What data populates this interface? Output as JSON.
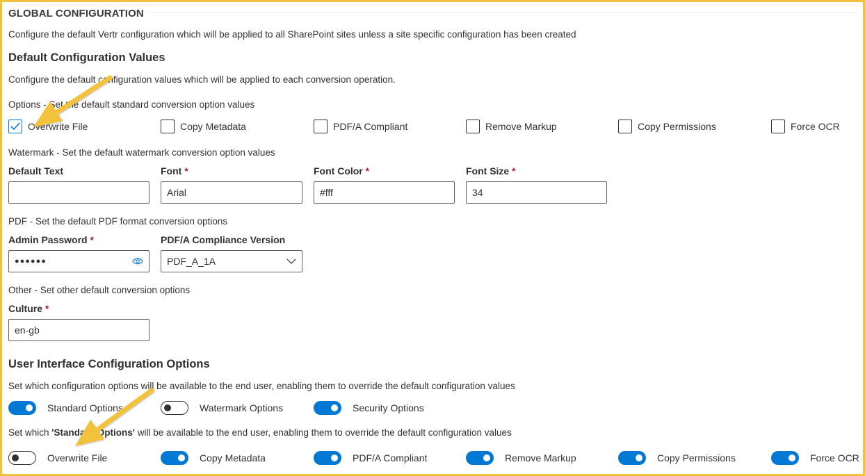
{
  "header": {
    "title": "GLOBAL CONFIGURATION",
    "description": "Configure the default Vertr configuration which will be applied to all SharePoint sites unless a site specific configuration has been created"
  },
  "defaults": {
    "heading": "Default Configuration Values",
    "description": "Configure the default configuration values which will be applied to each conversion operation."
  },
  "options": {
    "label": "Options",
    "description": " - Set the default standard conversion option values",
    "items": [
      {
        "label": "Overwrite File",
        "checked": true
      },
      {
        "label": "Copy Metadata",
        "checked": false
      },
      {
        "label": "PDF/A Compliant",
        "checked": false
      },
      {
        "label": "Remove Markup",
        "checked": false
      },
      {
        "label": "Copy Permissions",
        "checked": false
      },
      {
        "label": "Force OCR",
        "checked": false
      }
    ]
  },
  "watermark": {
    "label": "Watermark",
    "description": " - Set the default watermark conversion option values",
    "fields": [
      {
        "label": "Default Text",
        "required": "",
        "value": ""
      },
      {
        "label": "Font",
        "required": "*",
        "value": "Arial"
      },
      {
        "label": "Font Color",
        "required": "*",
        "value": "#fff"
      },
      {
        "label": "Font Size",
        "required": "*",
        "value": "34"
      }
    ]
  },
  "pdf": {
    "label": "PDF",
    "description": " - Set the default PDF format conversion options",
    "password_label": "Admin Password",
    "password_required": "*",
    "password_value": "●●●●●●",
    "compliance_label": "PDF/A Compliance Version",
    "compliance_value": "PDF_A_1A"
  },
  "other": {
    "label": "Other",
    "description": " - Set other default conversion options",
    "culture_label": "Culture",
    "culture_required": "*",
    "culture_value": "en-gb"
  },
  "ui_options": {
    "heading": "User Interface Configuration Options",
    "description": "Set which configuration options will be available to the end user, enabling them to override the default configuration values",
    "toggles": [
      {
        "label": "Standard Options",
        "on": true
      },
      {
        "label": "Watermark Options",
        "on": false
      },
      {
        "label": "Security Options",
        "on": true
      }
    ],
    "standard_prefix": "Set which ",
    "standard_bold": "'Standard Options'",
    "standard_suffix": " will be available to the end user, enabling them to override the default configuration values",
    "standard_toggles": [
      {
        "label": "Overwrite File",
        "on": false
      },
      {
        "label": "Copy Metadata",
        "on": true
      },
      {
        "label": "PDF/A Compliant",
        "on": true
      },
      {
        "label": "Remove Markup",
        "on": true
      },
      {
        "label": "Copy Permissions",
        "on": true
      },
      {
        "label": "Force OCR",
        "on": true
      }
    ]
  },
  "colors": {
    "accent": "#0078d4",
    "arrow": "#f2c23e",
    "frame": "#f2c23e"
  },
  "icons": {
    "checkmark": "checkmark-icon",
    "eye": "eye-icon",
    "chevron": "chevron-down-icon"
  }
}
